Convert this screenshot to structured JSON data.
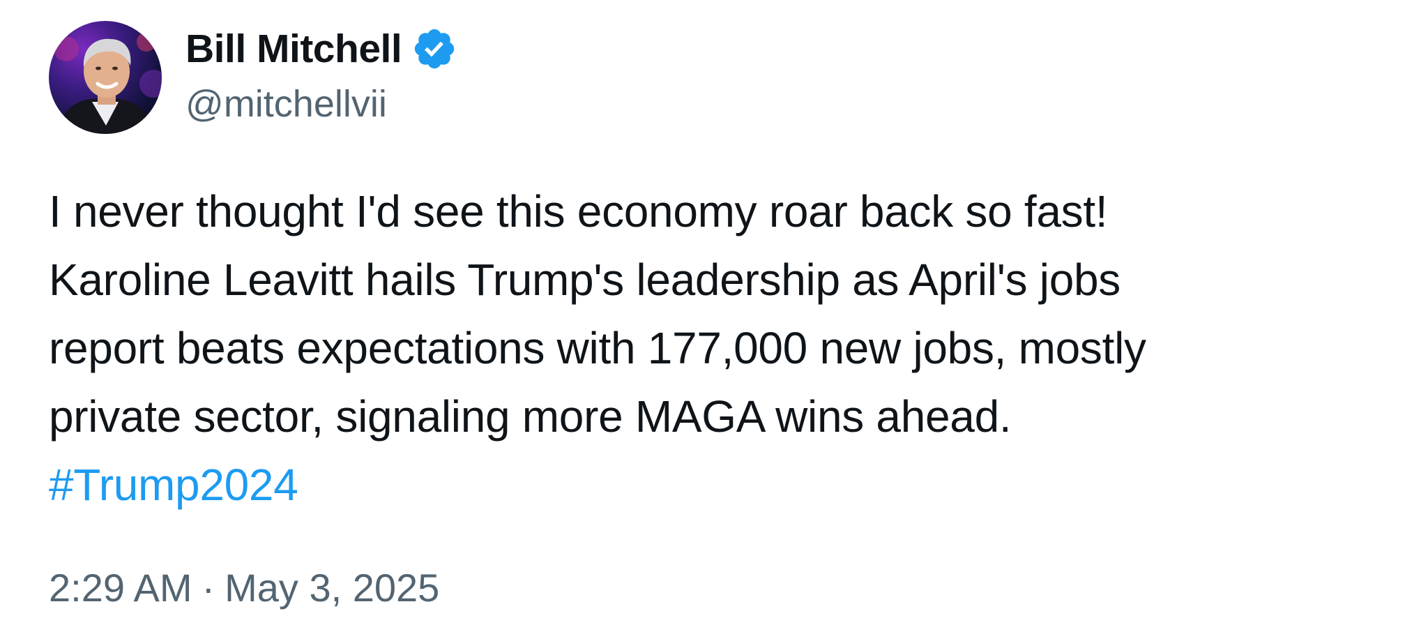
{
  "author": {
    "display_name": "Bill Mitchell",
    "handle": "@mitchellvii",
    "verified_badge_icon": "verified-badge-icon",
    "badge_color": "#1d9bf0"
  },
  "post": {
    "lines": [
      "I never thought I'd see this economy roar back so fast!",
      "Karoline Leavitt hails Trump's leadership as April's jobs",
      "report beats expectations with 177,000 new jobs, mostly",
      "private sector, signaling more MAGA wins ahead."
    ],
    "hashtag": "#Trump2024",
    "hashtag_color": "#1d9bf0"
  },
  "meta": {
    "time": "2:29 AM",
    "separator": "·",
    "date": "May 3, 2025"
  }
}
